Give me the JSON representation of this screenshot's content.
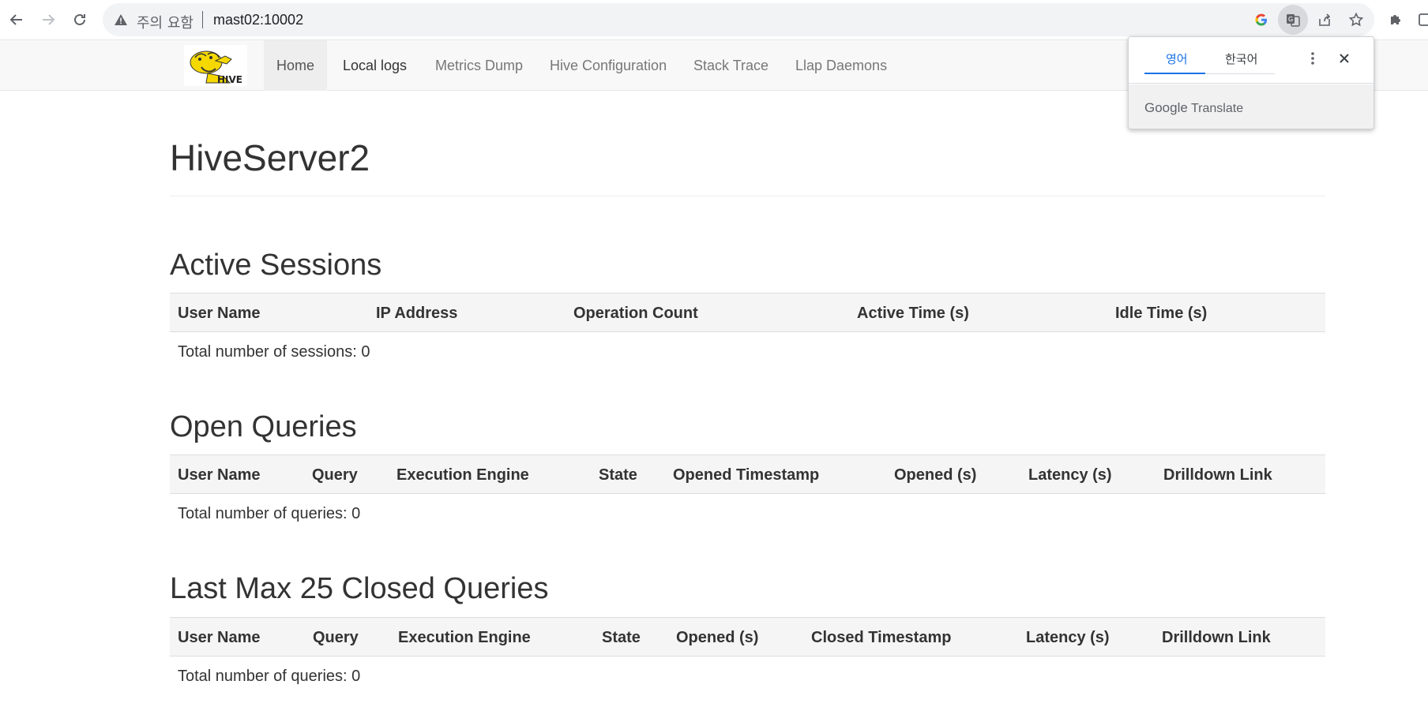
{
  "browser": {
    "security_label": "주의 요함",
    "url": "mast02:10002"
  },
  "navbar": {
    "items": [
      {
        "label": "Home"
      },
      {
        "label": "Local logs"
      },
      {
        "label": "Metrics Dump"
      },
      {
        "label": "Hive Configuration"
      },
      {
        "label": "Stack Trace"
      },
      {
        "label": "Llap Daemons"
      }
    ]
  },
  "page": {
    "title": "HiveServer2"
  },
  "active_sessions": {
    "title": "Active Sessions",
    "columns": [
      "User Name",
      "IP Address",
      "Operation Count",
      "Active Time (s)",
      "Idle Time (s)"
    ],
    "total": "Total number of sessions: 0"
  },
  "open_queries": {
    "title": "Open Queries",
    "columns": [
      "User Name",
      "Query",
      "Execution Engine",
      "State",
      "Opened Timestamp",
      "Opened (s)",
      "Latency (s)",
      "Drilldown Link"
    ],
    "total": "Total number of queries: 0"
  },
  "closed_queries": {
    "title": "Last Max 25 Closed Queries",
    "columns": [
      "User Name",
      "Query",
      "Execution Engine",
      "State",
      "Opened (s)",
      "Closed Timestamp",
      "Latency (s)",
      "Drilldown Link"
    ],
    "total": "Total number of queries: 0"
  },
  "translate_popup": {
    "tab_source": "영어",
    "tab_target": "한국어",
    "brand_google": "Google",
    "brand_translate": "Translate"
  },
  "colors": {
    "accent_blue": "#1a73e8",
    "navbar_bg": "#f8f8f8",
    "table_head_bg": "#f5f5f5"
  }
}
